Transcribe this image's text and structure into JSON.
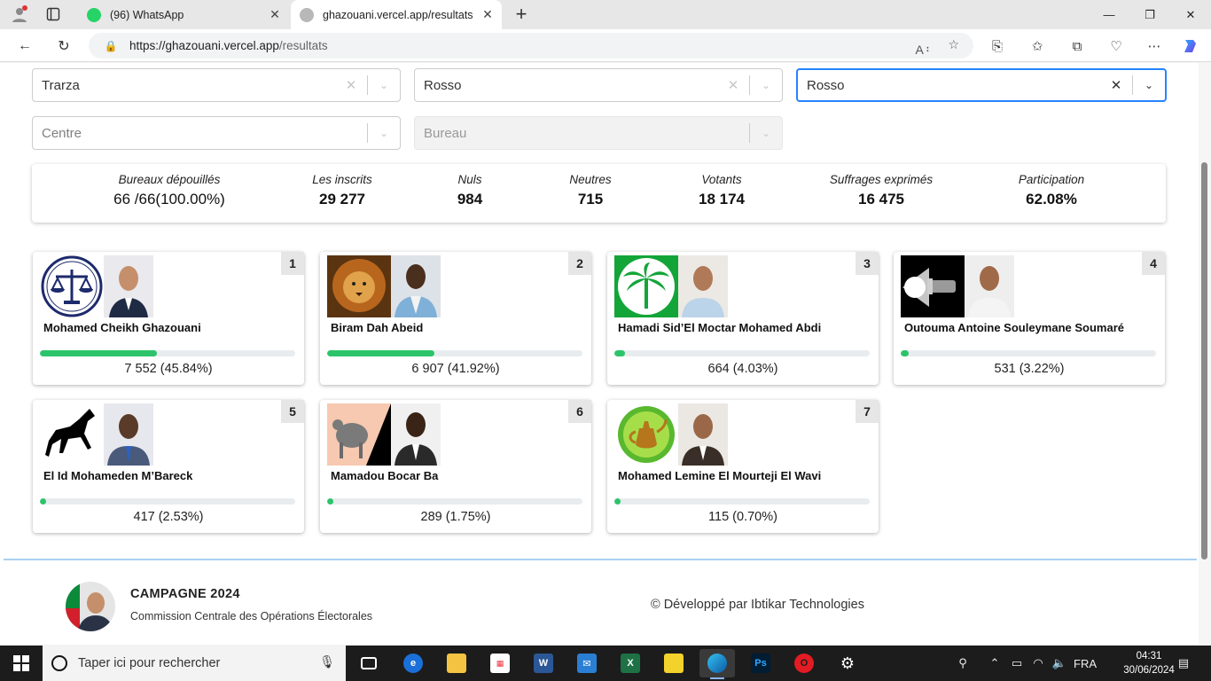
{
  "browser": {
    "tabs": [
      {
        "title": "(96) WhatsApp",
        "active": false
      },
      {
        "title": "ghazouani.vercel.app/resultats",
        "active": true
      }
    ],
    "url": {
      "host": "https://ghazouani.vercel.app",
      "path": "/resultats"
    }
  },
  "filters": {
    "region": {
      "value": "Trarza"
    },
    "department": {
      "value": "Rosso"
    },
    "commune": {
      "value": "Rosso"
    },
    "centre": {
      "placeholder": "Centre"
    },
    "bureau": {
      "placeholder": "Bureau"
    }
  },
  "stats": {
    "bureaux": {
      "label": "Bureaux dépouillés",
      "value": "66 /66(100.00%)"
    },
    "inscrits": {
      "label": "Les inscrits",
      "value": "29 277"
    },
    "nuls": {
      "label": "Nuls",
      "value": "984"
    },
    "neutres": {
      "label": "Neutres",
      "value": "715"
    },
    "votants": {
      "label": "Votants",
      "value": "18 174"
    },
    "exprimes": {
      "label": "Suffrages exprimés",
      "value": "16 475"
    },
    "participation": {
      "label": "Participation",
      "value": "62.08%"
    }
  },
  "candidates": [
    {
      "rank": "1",
      "name": "Mohamed Cheikh Ghazouani",
      "votes": "7 552 (45.84%)",
      "percent": 45.84,
      "symbol": "balance-scale-icon"
    },
    {
      "rank": "2",
      "name": "Biram Dah Abeid",
      "votes": "6 907 (41.92%)",
      "percent": 41.92,
      "symbol": "lion-icon"
    },
    {
      "rank": "3",
      "name": "Hamadi Sid’El Moctar Mohamed Abdi",
      "votes": "664 (4.03%)",
      "percent": 4.03,
      "symbol": "palm-tree-icon"
    },
    {
      "rank": "4",
      "name": "Outouma Antoine Souleymane Soumaré",
      "votes": "531 (3.22%)",
      "percent": 3.22,
      "symbol": "flashlight-icon"
    },
    {
      "rank": "5",
      "name": "El Id Mohameden M’Bareck",
      "votes": "417 (2.53%)",
      "percent": 2.53,
      "symbol": "horse-icon"
    },
    {
      "rank": "6",
      "name": "Mamadou Bocar Ba",
      "votes": "289 (1.75%)",
      "percent": 1.75,
      "symbol": "zebu-icon"
    },
    {
      "rank": "7",
      "name": "Mohamed Lemine El Mourteji El Wavi",
      "votes": "115 (0.70%)",
      "percent": 0.7,
      "symbol": "teapot-icon"
    }
  ],
  "footer": {
    "brand": "CAMPAGNE 2024",
    "subtitle": "Commission Centrale des Opérations Électorales",
    "copyright": "© Développé par Ibtikar Technologies"
  },
  "taskbar": {
    "search_placeholder": "Taper ici pour rechercher",
    "language": "FRA",
    "time": "04:31",
    "date": "30/06/2024"
  },
  "colors": {
    "progress": "#2cc46a",
    "focus": "#2684ff",
    "footer_border": "#a8d0f0"
  }
}
